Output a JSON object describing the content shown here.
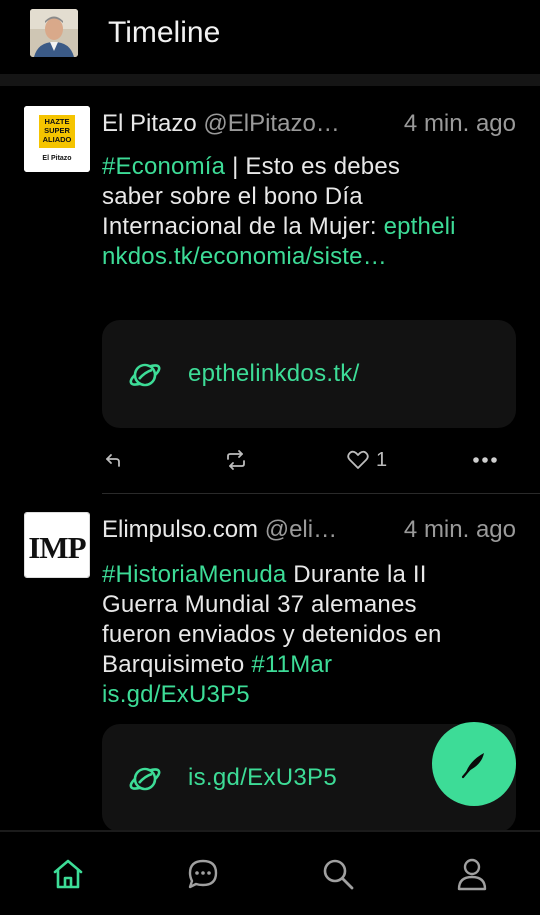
{
  "header": {
    "title": "Timeline",
    "avatar_icon": "user-avatar-photo"
  },
  "posts": [
    {
      "name": "El Pitazo",
      "handle": "@ElPitazo…",
      "time": "4 min. ago",
      "avatar_lines": [
        "HAZTE",
        "SUPER",
        "ALIADO",
        "El Pitazo"
      ],
      "hashtag": "#Economía",
      "text": " | Esto es debes saber sobre el bono Día Internacional de la Mujer: ",
      "link_text": "epthelinkdos.tk/economia/siste…",
      "card_link": "epthelinkdos.tk/",
      "like_count": "1"
    },
    {
      "name": "Elimpulso.com",
      "handle": "@eli…",
      "time": "4 min. ago",
      "avatar_text": "IMP",
      "hashtag": "#HistoriaMenuda",
      "text": " Durante la II Guerra Mundial 37 alemanes fueron enviados y detenidos en Barquisimeto ",
      "hashtag2": "#11Mar",
      "link_text": "is.gd/ExU3P5",
      "card_link": "is.gd/ExU3P5"
    }
  ],
  "nav": {
    "items": [
      "home",
      "messages",
      "search",
      "profile"
    ]
  },
  "colors": {
    "accent": "#3ddc97",
    "background": "#000000",
    "card": "#121212",
    "muted": "#9a9a9a"
  }
}
